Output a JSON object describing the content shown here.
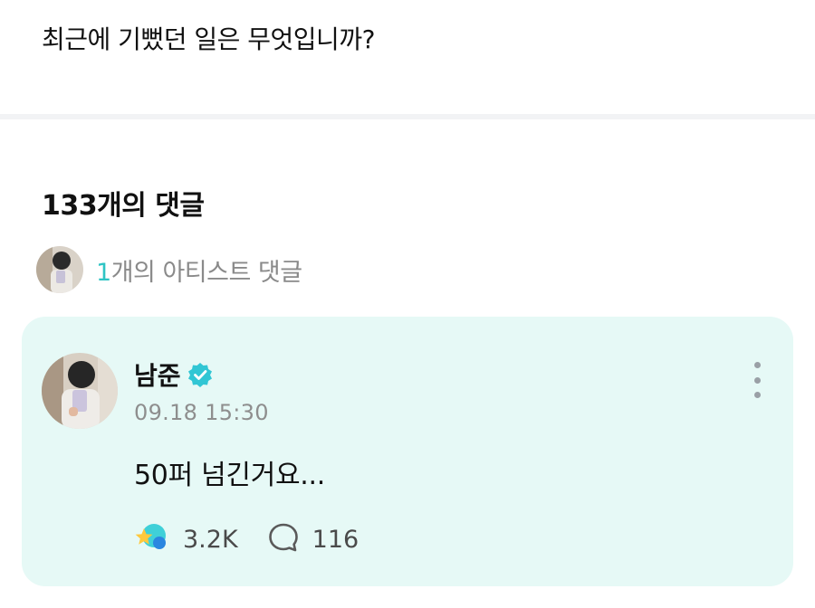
{
  "post": {
    "text": "최근에 기뻤던 일은 무엇입니까?"
  },
  "comments": {
    "count_label": "133개의 댓글",
    "artist_summary": {
      "count": "1",
      "label": "개의 아티스트 댓글"
    }
  },
  "artist_comment": {
    "author": "남준",
    "verified_icon": "verified-check-icon",
    "timestamp": "09.18 15:30",
    "body": "50퍼 넘긴거요...",
    "likes": "3.2K",
    "replies": "116"
  },
  "colors": {
    "accent": "#2ec4c4",
    "card_background": "#e6f9f6",
    "divider": "#f2f3f5"
  }
}
